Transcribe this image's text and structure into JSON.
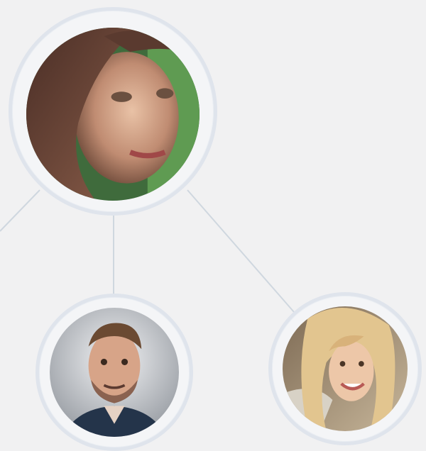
{
  "chart": {
    "root": {
      "avatar": "woman-with-long-brown-hair-portrait"
    },
    "children": [
      {
        "avatar": "smiling-man-with-beard-portrait"
      },
      {
        "avatar": "smiling-blonde-woman-portrait"
      }
    ]
  },
  "colors": {
    "background": "#f1f1f2",
    "ring": "#dfe4ec",
    "connector": "#cfd7df"
  }
}
